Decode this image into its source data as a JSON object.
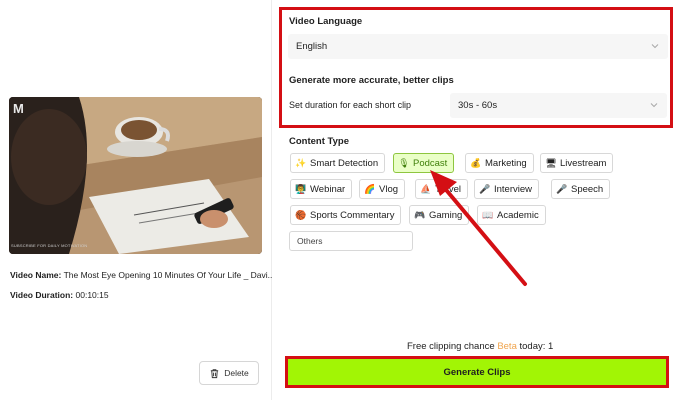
{
  "video": {
    "logo": "M",
    "caption": "SUBSCRIBE FOR DAILY MOTIVATION",
    "name_key": "Video Name:",
    "name_value": "The Most Eye Opening 10 Minutes Of Your Life _ Davi...",
    "duration_key": "Video Duration:",
    "duration_value": "00:10:15",
    "delete_label": "Delete"
  },
  "settings": {
    "language_label": "Video Language",
    "language_value": "English",
    "accuracy_label": "Generate more accurate, better clips",
    "duration_label": "Set duration for each short clip",
    "duration_value": "30s - 60s"
  },
  "content_type": {
    "label": "Content Type",
    "chips": [
      {
        "label": "Smart Detection",
        "icon": "✨"
      },
      {
        "label": "Podcast",
        "icon": "🎙",
        "selected": true
      },
      {
        "label": "Marketing",
        "icon": "💰"
      },
      {
        "label": "Livestream",
        "icon": "🖥"
      },
      {
        "label": "Webinar",
        "icon": "👨‍🏫"
      },
      {
        "label": "Vlog",
        "icon": "🌈"
      },
      {
        "label": "Travel",
        "icon": "⛵"
      },
      {
        "label": "Interview",
        "icon": "🎤"
      },
      {
        "label": "Speech",
        "icon": "🎤"
      },
      {
        "label": "Sports Commentary",
        "icon": "🏀"
      },
      {
        "label": "Gaming",
        "icon": "🎮"
      },
      {
        "label": "Academic",
        "icon": "📖"
      },
      {
        "label": "Others",
        "icon": ""
      }
    ]
  },
  "footer": {
    "free_prefix": "Free clipping chance ",
    "free_beta": "Beta",
    "free_suffix": " today: 1",
    "generate_label": "Generate Clips"
  },
  "colors": {
    "highlight_red": "#d40f14",
    "generate_green": "#a2f505",
    "selected_chip_bg": "#eaffc7",
    "beta_orange": "#f0a44d"
  }
}
